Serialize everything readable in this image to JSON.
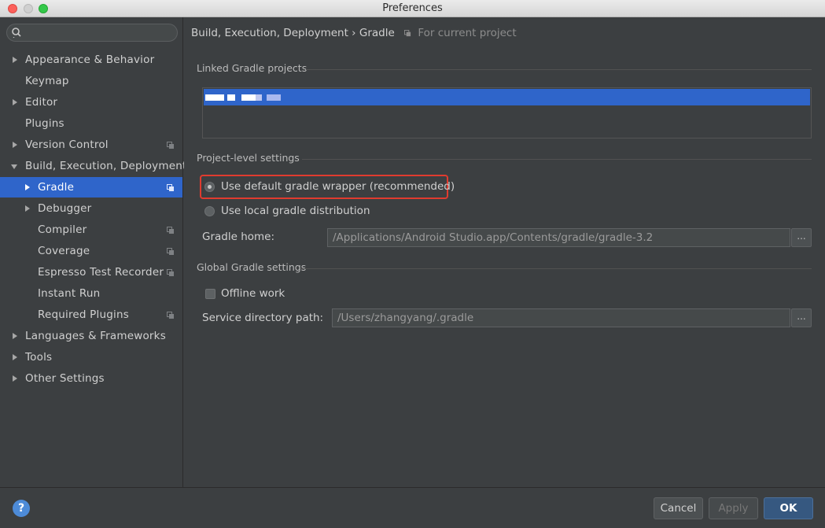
{
  "window": {
    "title": "Preferences"
  },
  "sidebar": {
    "search": {
      "placeholder": "",
      "value": ""
    },
    "items": [
      {
        "label": "Appearance & Behavior",
        "expandable": true,
        "expanded": false,
        "indent": 0,
        "icon": "",
        "selected": false
      },
      {
        "label": "Keymap",
        "expandable": false,
        "indent": 0,
        "icon": "",
        "selected": false
      },
      {
        "label": "Editor",
        "expandable": true,
        "expanded": false,
        "indent": 0,
        "icon": "",
        "selected": false
      },
      {
        "label": "Plugins",
        "expandable": false,
        "indent": 0,
        "icon": "",
        "selected": false
      },
      {
        "label": "Version Control",
        "expandable": true,
        "expanded": false,
        "indent": 0,
        "icon": "copy-icon",
        "selected": false
      },
      {
        "label": "Build, Execution, Deployment",
        "expandable": true,
        "expanded": true,
        "indent": 0,
        "icon": "",
        "selected": false
      },
      {
        "label": "Gradle",
        "expandable": true,
        "expanded": false,
        "indent": 1,
        "icon": "copy-icon",
        "selected": true
      },
      {
        "label": "Debugger",
        "expandable": true,
        "expanded": false,
        "indent": 1,
        "icon": "",
        "selected": false
      },
      {
        "label": "Compiler",
        "expandable": false,
        "indent": 1,
        "icon": "copy-icon",
        "selected": false
      },
      {
        "label": "Coverage",
        "expandable": false,
        "indent": 1,
        "icon": "copy-icon",
        "selected": false
      },
      {
        "label": "Espresso Test Recorder",
        "expandable": false,
        "indent": 1,
        "icon": "copy-icon",
        "selected": false
      },
      {
        "label": "Instant Run",
        "expandable": false,
        "indent": 1,
        "icon": "",
        "selected": false
      },
      {
        "label": "Required Plugins",
        "expandable": false,
        "indent": 1,
        "icon": "copy-icon",
        "selected": false
      },
      {
        "label": "Languages & Frameworks",
        "expandable": true,
        "expanded": false,
        "indent": 0,
        "icon": "",
        "selected": false
      },
      {
        "label": "Tools",
        "expandable": true,
        "expanded": false,
        "indent": 0,
        "icon": "",
        "selected": false
      },
      {
        "label": "Other Settings",
        "expandable": true,
        "expanded": false,
        "indent": 0,
        "icon": "",
        "selected": false
      }
    ]
  },
  "content": {
    "breadcrumb": {
      "path": "Build,  Execution,  Deployment › Gradle",
      "scope": "For current project"
    },
    "linked_projects": {
      "title": "Linked Gradle projects"
    },
    "project_level": {
      "title": "Project-level settings",
      "option_default_wrapper": "Use default gradle wrapper (recommended)",
      "option_local_distribution": "Use local gradle distribution",
      "selected_option": "default_wrapper",
      "gradle_home_label": "Gradle home:",
      "gradle_home_value": "/Applications/Android Studio.app/Contents/gradle/gradle-3.2",
      "browse_label": "..."
    },
    "global": {
      "title": "Global Gradle settings",
      "offline_work_label": "Offline work",
      "offline_work_checked": false,
      "service_dir_label": "Service directory path:",
      "service_dir_value": "/Users/zhangyang/.gradle",
      "browse_label": "..."
    }
  },
  "footer": {
    "help_label": "?",
    "cancel_label": "Cancel",
    "apply_label": "Apply",
    "ok_label": "OK"
  },
  "colors": {
    "selection": "#2f65ca",
    "background": "#3c3f41",
    "highlight_border": "#e03b2f",
    "primary_button": "#365880"
  }
}
